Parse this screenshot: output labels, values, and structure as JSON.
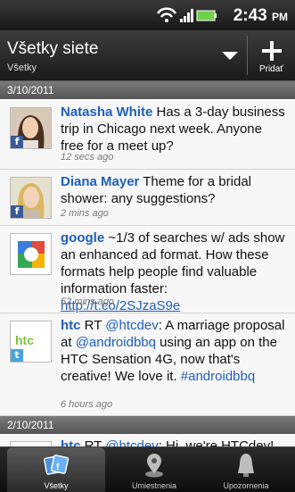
{
  "status_bar": {
    "time": "2:43",
    "ampm": "PM"
  },
  "header": {
    "title": "Všetky siete",
    "subtitle": "Všetky",
    "add_label": "Pridať"
  },
  "dates": [
    "3/10/2011",
    "2/10/2011"
  ],
  "posts": [
    {
      "name": "Natasha White",
      "text": " Has a 3-day business trip in Chicago next week. Anyone free for a meet up?",
      "time": "12 secs ago"
    },
    {
      "name": "Diana Mayer",
      "text": " Theme for a bridal shower: any suggestions?",
      "time": "2 mins ago"
    },
    {
      "name": "google",
      "text": " ~1/3 of searches w/ ads show an enhanced ad format. How these formats help people find valuable information faster: ",
      "link": "http://t.co/2SJzaS9e",
      "time": "52 mins ago"
    },
    {
      "name": "htc",
      "rt": " RT ",
      "mention1": "@htcdev",
      "text1": ": A marriage proposal at ",
      "mention2": "@androidbbq",
      "text2": " using an app on the HTC Sensation 4G, now that's creative! We love it. ",
      "hashtag": "#androidbbq",
      "time": "6 hours ago"
    },
    {
      "name": "htc",
      "rt": " RT ",
      "mention1": "@htcdev",
      "text1": ": Hi, we're HTCdev! Come check us out at the Big Android BBQ"
    }
  ],
  "tabs": [
    {
      "label": "Všetky"
    },
    {
      "label": "Umiestnenia"
    },
    {
      "label": "Upozornenia"
    }
  ],
  "colors": {
    "link": "#1f5fb8",
    "facebook": "#3b5998"
  },
  "icons": [
    "wifi-icon",
    "signal-icon",
    "battery-icon",
    "dropdown-arrow-icon",
    "add-icon",
    "facebook-icon",
    "social-tab-icon",
    "location-pin-icon",
    "bell-icon"
  ]
}
